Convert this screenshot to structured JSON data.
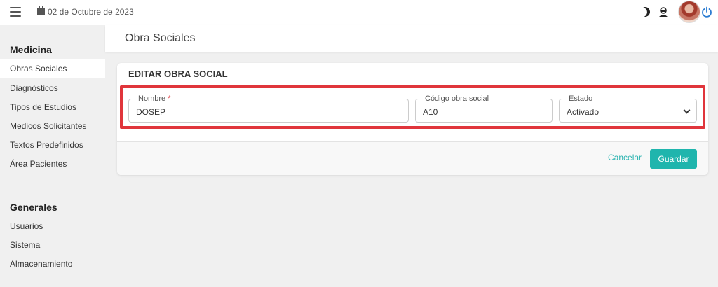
{
  "topbar": {
    "date": "02 de Octubre de 2023"
  },
  "sidebar": {
    "section_medicina": "Medicina",
    "medicina_items": [
      {
        "label": "Obras Sociales",
        "active": true
      },
      {
        "label": "Diagnósticos"
      },
      {
        "label": "Tipos de Estudios"
      },
      {
        "label": "Medicos Solicitantes"
      },
      {
        "label": "Textos Predefinidos"
      },
      {
        "label": "Área Pacientes"
      }
    ],
    "section_generales": "Generales",
    "generales_items": [
      {
        "label": "Usuarios"
      },
      {
        "label": "Sistema"
      },
      {
        "label": "Almacenamiento"
      }
    ]
  },
  "page": {
    "title": "Obra Sociales"
  },
  "card": {
    "title": "EDITAR OBRA SOCIAL",
    "fields": {
      "nombre": {
        "label": "Nombre",
        "required_mark": "*",
        "value": "DOSEP"
      },
      "codigo": {
        "label": "Código obra social",
        "value": "A10"
      },
      "estado": {
        "label": "Estado",
        "value": "Activado"
      }
    },
    "cancel_label": "Cancelar",
    "save_label": "Guardar"
  },
  "colors": {
    "accent": "#1fb5ad",
    "highlight_border": "#e0353b",
    "required": "#e0353b"
  },
  "icons": [
    "menu-icon",
    "calendar-icon",
    "moon-icon",
    "support-icon",
    "avatar",
    "power-icon",
    "chevron-down-icon"
  ]
}
